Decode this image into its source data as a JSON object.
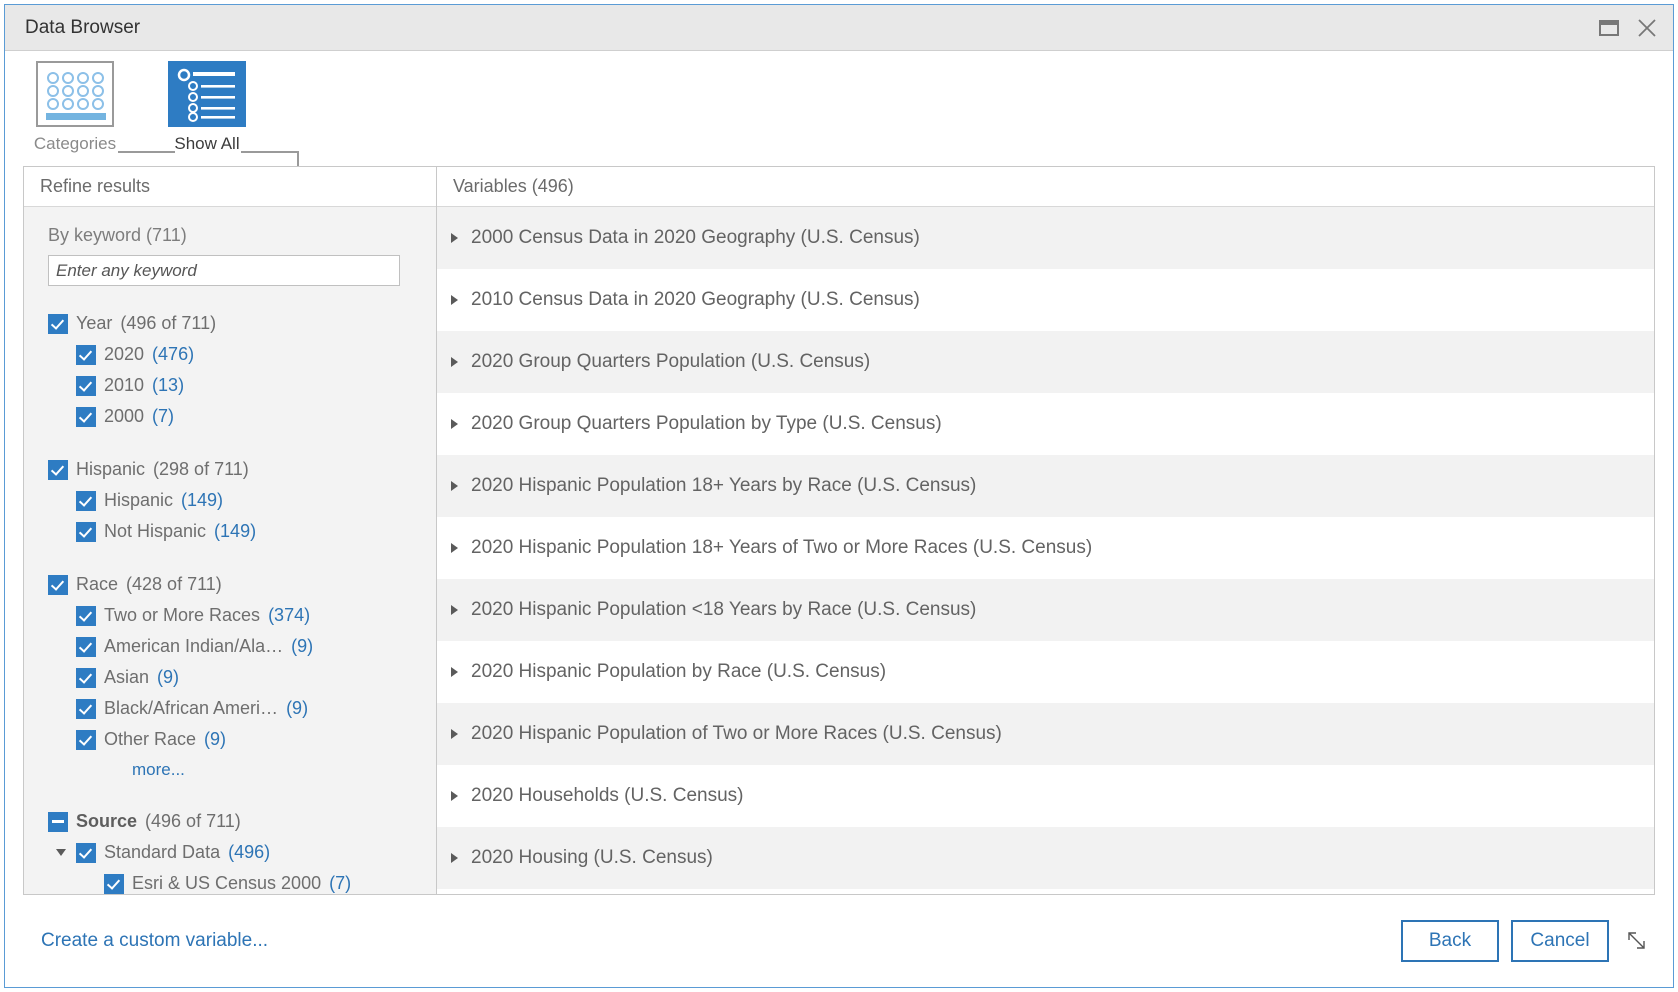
{
  "window": {
    "title": "Data Browser",
    "restore_icon": "restore-window-icon",
    "close_icon": "close-icon"
  },
  "tabs": [
    {
      "id": "categories",
      "label": "Categories",
      "icon": "categories-grid-icon",
      "active": false
    },
    {
      "id": "show_all",
      "label": "Show All",
      "icon": "list-bullets-icon",
      "active": true
    }
  ],
  "left_panel": {
    "header": "Refine results",
    "keyword": {
      "label": "By keyword (711)",
      "placeholder": "Enter any keyword",
      "value": ""
    },
    "groups": [
      {
        "id": "year",
        "label": "Year",
        "count": "(496 of 711)",
        "checkbox": "checked",
        "bold": false,
        "children": [
          {
            "label": "2020",
            "count": "(476)",
            "checkbox": "checked"
          },
          {
            "label": "2010",
            "count": "(13)",
            "checkbox": "checked"
          },
          {
            "label": "2000",
            "count": "(7)",
            "checkbox": "checked"
          }
        ]
      },
      {
        "id": "hispanic",
        "label": "Hispanic",
        "count": "(298 of 711)",
        "checkbox": "checked",
        "bold": false,
        "children": [
          {
            "label": "Hispanic",
            "count": "(149)",
            "checkbox": "checked"
          },
          {
            "label": "Not Hispanic",
            "count": "(149)",
            "checkbox": "checked"
          }
        ]
      },
      {
        "id": "race",
        "label": "Race",
        "count": "(428 of 711)",
        "checkbox": "checked",
        "bold": false,
        "children": [
          {
            "label": "Two or More Races",
            "count": "(374)",
            "checkbox": "checked"
          },
          {
            "label": "American Indian/Ala…",
            "count": "(9)",
            "checkbox": "checked"
          },
          {
            "label": "Asian",
            "count": "(9)",
            "checkbox": "checked"
          },
          {
            "label": "Black/African Ameri…",
            "count": "(9)",
            "checkbox": "checked"
          },
          {
            "label": "Other Race",
            "count": "(9)",
            "checkbox": "checked"
          }
        ],
        "more_label": "more..."
      },
      {
        "id": "source",
        "label": "Source",
        "count": "(496 of 711)",
        "checkbox": "indeterminate",
        "bold": true,
        "children": [
          {
            "label": "Standard Data",
            "count": "(496)",
            "checkbox": "checked",
            "expander": "expanded"
          }
        ],
        "grandchildren": [
          {
            "label": "Esri & US Census 2000",
            "count": "(7)",
            "checkbox": "checked"
          }
        ]
      }
    ]
  },
  "right_panel": {
    "header": "Variables (496)",
    "items": [
      {
        "label": "2000 Census Data in 2020 Geography (U.S. Census)"
      },
      {
        "label": "2010 Census Data in 2020 Geography (U.S. Census)"
      },
      {
        "label": "2020 Group Quarters Population (U.S. Census)"
      },
      {
        "label": "2020 Group Quarters Population by Type (U.S. Census)"
      },
      {
        "label": "2020 Hispanic Population 18+ Years by Race (U.S. Census)"
      },
      {
        "label": "2020 Hispanic Population 18+ Years of Two or More Races (U.S. Census)"
      },
      {
        "label": "2020 Hispanic Population <18 Years by Race (U.S. Census)"
      },
      {
        "label": "2020 Hispanic Population by Race (U.S. Census)"
      },
      {
        "label": "2020 Hispanic Population of Two or More Races (U.S. Census)"
      },
      {
        "label": "2020 Households (U.S. Census)"
      },
      {
        "label": "2020 Housing (U.S. Census)"
      }
    ]
  },
  "footer": {
    "custom_variable_link": "Create a custom variable...",
    "back_label": "Back",
    "cancel_label": "Cancel",
    "resize_grip_icon": "resize-grip-icon"
  },
  "colors": {
    "accent": "#2d74b5",
    "checkbox_fill": "#2e7cc3",
    "titlebar_bg": "#e8e8e8",
    "panel_bg": "#f3f3f3",
    "row_alt_bg": "#f2f2f2"
  }
}
